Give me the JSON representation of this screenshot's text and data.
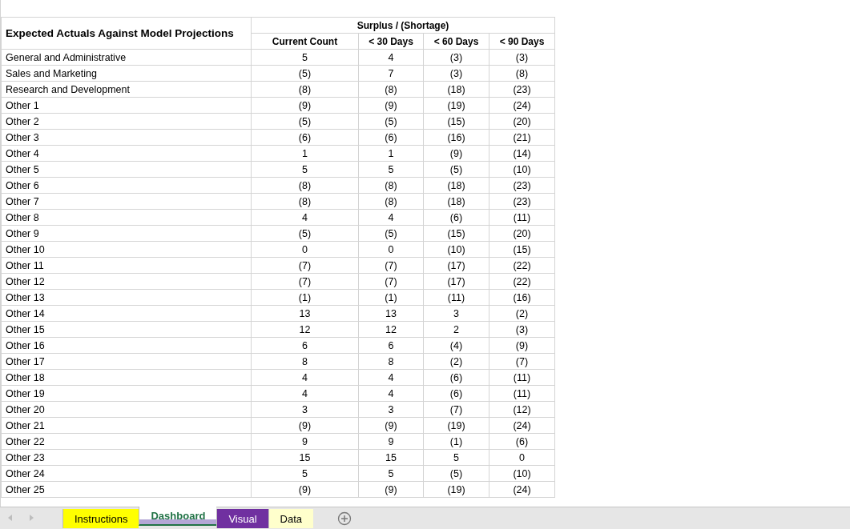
{
  "table": {
    "title": "Expected Actuals Against Model Projections",
    "group_header": "Surplus / (Shortage)",
    "columns": [
      "Current Count",
      "< 30 Days",
      "< 60 Days",
      "< 90 Days"
    ],
    "rows": [
      {
        "label": "General and Administrative",
        "values": [
          "5",
          "4",
          "(3)",
          "(3)"
        ]
      },
      {
        "label": "Sales and Marketing",
        "values": [
          "(5)",
          "7",
          "(3)",
          "(8)"
        ]
      },
      {
        "label": "Research and Development",
        "values": [
          "(8)",
          "(8)",
          "(18)",
          "(23)"
        ]
      },
      {
        "label": "Other 1",
        "values": [
          "(9)",
          "(9)",
          "(19)",
          "(24)"
        ]
      },
      {
        "label": "Other 2",
        "values": [
          "(5)",
          "(5)",
          "(15)",
          "(20)"
        ]
      },
      {
        "label": "Other 3",
        "values": [
          "(6)",
          "(6)",
          "(16)",
          "(21)"
        ]
      },
      {
        "label": "Other 4",
        "values": [
          "1",
          "1",
          "(9)",
          "(14)"
        ]
      },
      {
        "label": "Other 5",
        "values": [
          "5",
          "5",
          "(5)",
          "(10)"
        ]
      },
      {
        "label": "Other 6",
        "values": [
          "(8)",
          "(8)",
          "(18)",
          "(23)"
        ]
      },
      {
        "label": "Other 7",
        "values": [
          "(8)",
          "(8)",
          "(18)",
          "(23)"
        ]
      },
      {
        "label": "Other 8",
        "values": [
          "4",
          "4",
          "(6)",
          "(11)"
        ]
      },
      {
        "label": "Other 9",
        "values": [
          "(5)",
          "(5)",
          "(15)",
          "(20)"
        ]
      },
      {
        "label": "Other 10",
        "values": [
          "0",
          "0",
          "(10)",
          "(15)"
        ]
      },
      {
        "label": "Other 11",
        "values": [
          "(7)",
          "(7)",
          "(17)",
          "(22)"
        ]
      },
      {
        "label": "Other 12",
        "values": [
          "(7)",
          "(7)",
          "(17)",
          "(22)"
        ]
      },
      {
        "label": "Other 13",
        "values": [
          "(1)",
          "(1)",
          "(11)",
          "(16)"
        ]
      },
      {
        "label": "Other 14",
        "values": [
          "13",
          "13",
          "3",
          "(2)"
        ]
      },
      {
        "label": "Other 15",
        "values": [
          "12",
          "12",
          "2",
          "(3)"
        ]
      },
      {
        "label": "Other 16",
        "values": [
          "6",
          "6",
          "(4)",
          "(9)"
        ]
      },
      {
        "label": "Other 17",
        "values": [
          "8",
          "8",
          "(2)",
          "(7)"
        ]
      },
      {
        "label": "Other 18",
        "values": [
          "4",
          "4",
          "(6)",
          "(11)"
        ]
      },
      {
        "label": "Other 19",
        "values": [
          "4",
          "4",
          "(6)",
          "(11)"
        ]
      },
      {
        "label": "Other 20",
        "values": [
          "3",
          "3",
          "(7)",
          "(12)"
        ]
      },
      {
        "label": "Other 21",
        "values": [
          "(9)",
          "(9)",
          "(19)",
          "(24)"
        ]
      },
      {
        "label": "Other 22",
        "values": [
          "9",
          "9",
          "(1)",
          "(6)"
        ]
      },
      {
        "label": "Other 23",
        "values": [
          "15",
          "15",
          "5",
          "0"
        ]
      },
      {
        "label": "Other 24",
        "values": [
          "5",
          "5",
          "(5)",
          "(10)"
        ]
      },
      {
        "label": "Other 25",
        "values": [
          "(9)",
          "(9)",
          "(19)",
          "(24)"
        ]
      }
    ]
  },
  "sheet_tabs": [
    {
      "label": "Instructions",
      "selected": false,
      "color": "#ffff00"
    },
    {
      "label": "Dashboard",
      "selected": true,
      "color": "#b4a7d6"
    },
    {
      "label": "Visual",
      "selected": false,
      "color": "#7030a0"
    },
    {
      "label": "Data",
      "selected": false,
      "color": "#ffffcc"
    }
  ]
}
